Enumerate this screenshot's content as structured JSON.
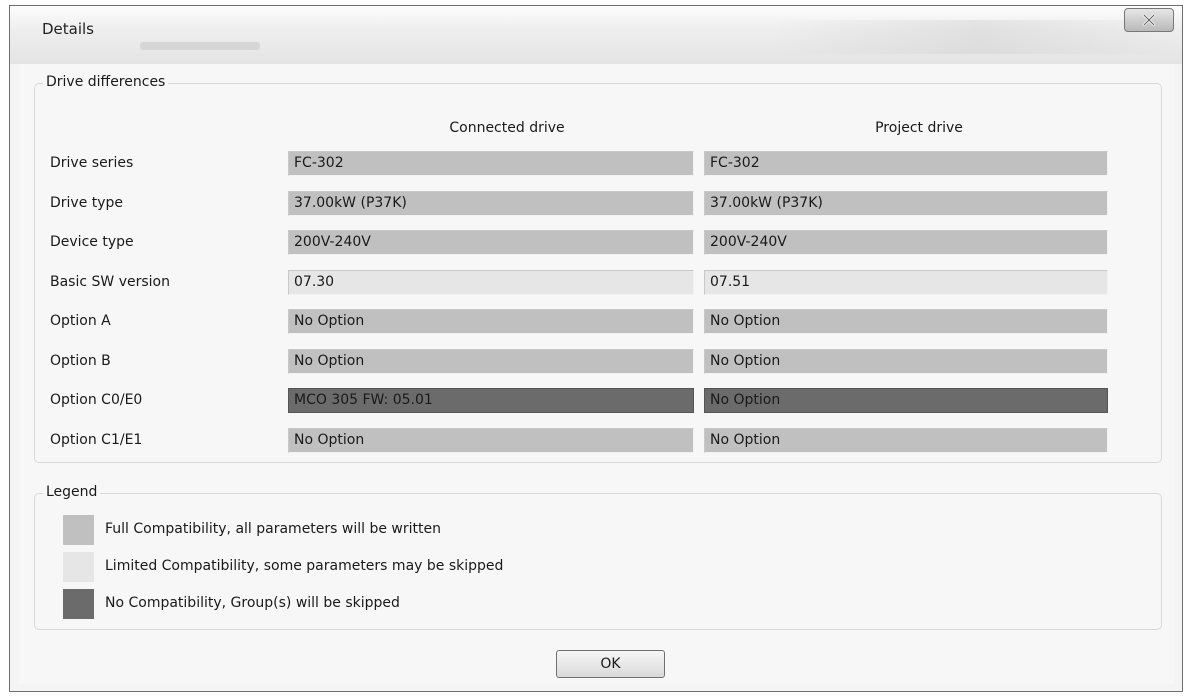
{
  "window": {
    "title": "Details",
    "close_icon": "close-x-icon"
  },
  "drive_differences": {
    "group_title": "Drive differences",
    "columns": [
      "Connected drive",
      "Project drive"
    ],
    "rows": [
      {
        "label": "Drive series",
        "connected": "FC-302",
        "project": "FC-302",
        "status": "full"
      },
      {
        "label": "Drive type",
        "connected": "37.00kW (P37K)",
        "project": "37.00kW (P37K)",
        "status": "full"
      },
      {
        "label": "Device type",
        "connected": "200V-240V",
        "project": "200V-240V",
        "status": "full"
      },
      {
        "label": "Basic SW version",
        "connected": "07.30",
        "project": "07.51",
        "status": "limited"
      },
      {
        "label": "Option A",
        "connected": "No Option",
        "project": "No Option",
        "status": "full"
      },
      {
        "label": "Option B",
        "connected": "No Option",
        "project": "No Option",
        "status": "full"
      },
      {
        "label": "Option C0/E0",
        "connected": "MCO 305 FW: 05.01",
        "project": "No Option",
        "status": "none"
      },
      {
        "label": "Option C1/E1",
        "connected": "No Option",
        "project": "No Option",
        "status": "full"
      }
    ]
  },
  "legend": {
    "group_title": "Legend",
    "items": [
      {
        "status": "full",
        "text": "Full Compatibility, all parameters will be written"
      },
      {
        "status": "limited",
        "text": "Limited Compatibility, some parameters may be skipped"
      },
      {
        "status": "none",
        "text": "No Compatibility, Group(s) will be skipped"
      }
    ]
  },
  "colors": {
    "full": "#c0c0c0",
    "limited": "#e6e6e6",
    "none": "#6b6b6b"
  },
  "footer": {
    "ok_label": "OK"
  }
}
